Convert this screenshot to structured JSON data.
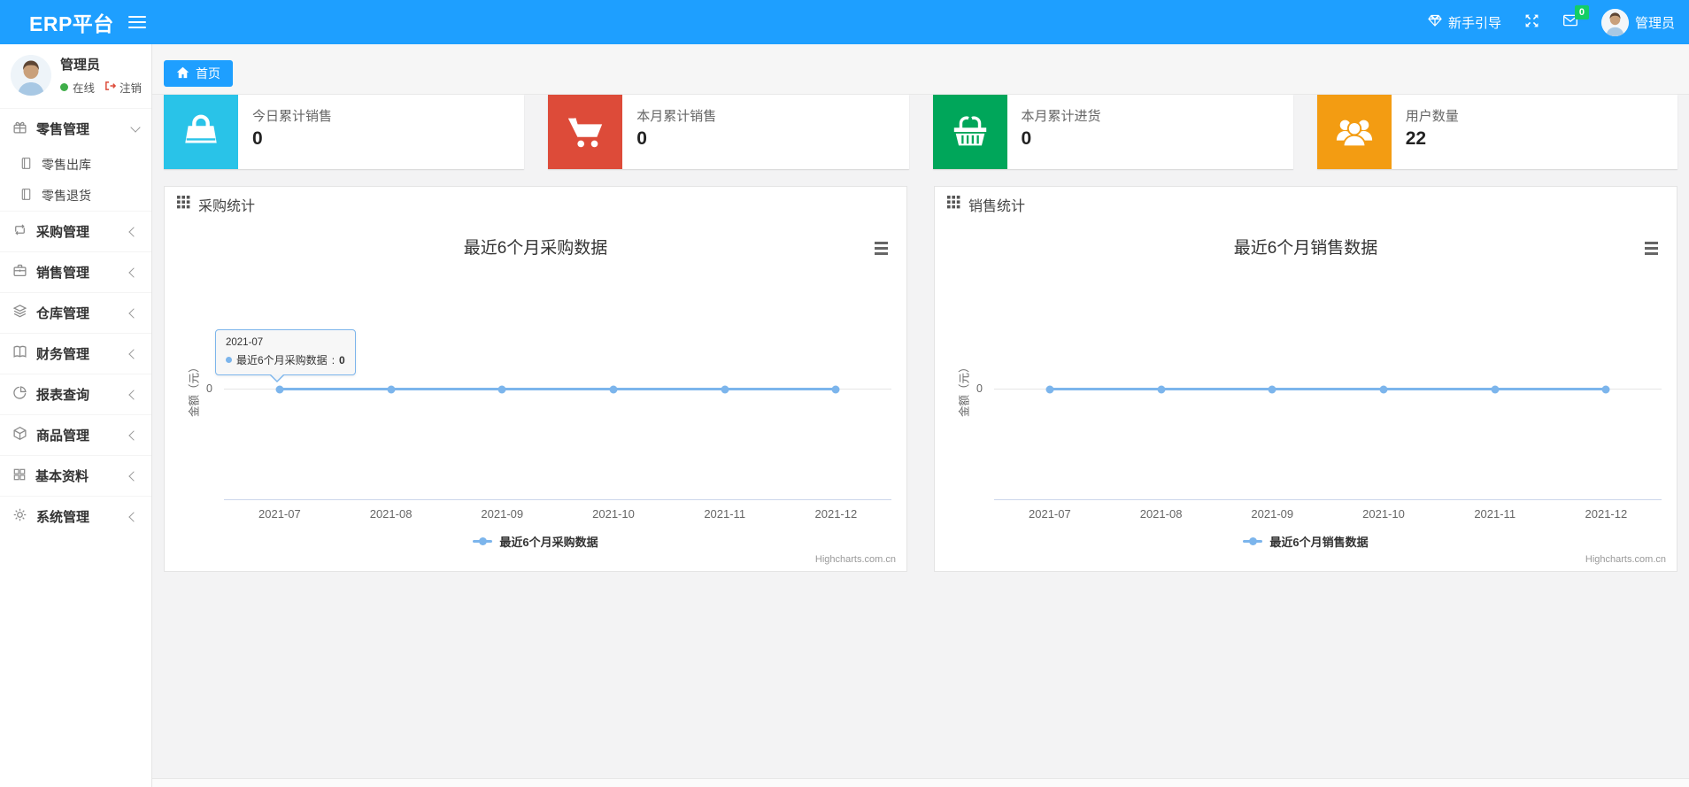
{
  "colors": {
    "accent": "#1e9fff",
    "series": "#7cb5ec",
    "online_green": "#3fae49",
    "badge_green": "#13ce66",
    "logout_red": "#dd4b39"
  },
  "navbar": {
    "brand": "ERP平台",
    "guide_label": "新手引导",
    "message_badge": "0",
    "username": "管理员"
  },
  "tabs": {
    "home_label": "首页"
  },
  "sidebar": {
    "user": {
      "name": "管理员",
      "status": "在线",
      "logout": "注销"
    },
    "menu": [
      {
        "label": "零售管理",
        "icon": "gift-icon",
        "state": "expanded"
      },
      {
        "label": "零售出库",
        "icon": "file-icon"
      },
      {
        "label": "零售退货",
        "icon": "file-icon"
      },
      {
        "label": "采购管理",
        "icon": "retweet-icon"
      },
      {
        "label": "销售管理",
        "icon": "briefcase-icon"
      },
      {
        "label": "仓库管理",
        "icon": "layers-icon"
      },
      {
        "label": "财务管理",
        "icon": "book-icon"
      },
      {
        "label": "报表查询",
        "icon": "pie-chart-icon"
      },
      {
        "label": "商品管理",
        "icon": "box-icon"
      },
      {
        "label": "基本资料",
        "icon": "grid-icon"
      },
      {
        "label": "系统管理",
        "icon": "gear-icon"
      }
    ]
  },
  "stat_cards": [
    {
      "label": "今日累计销售",
      "value": "0",
      "color": "#29c3e8",
      "icon": "shopping-bag-icon"
    },
    {
      "label": "本月累计销售",
      "value": "0",
      "color": "#dd4b39",
      "icon": "shopping-cart-icon"
    },
    {
      "label": "本月累计进货",
      "value": "0",
      "color": "#00a65a",
      "icon": "shopping-basket-icon"
    },
    {
      "label": "用户数量",
      "value": "22",
      "color": "#f39c12",
      "icon": "users-icon"
    }
  ],
  "panels": [
    {
      "header": "采购统计"
    },
    {
      "header": "销售统计"
    }
  ],
  "chart_data": [
    {
      "type": "line",
      "title": "最近6个月采购数据",
      "categories": [
        "2021-07",
        "2021-08",
        "2021-09",
        "2021-10",
        "2021-11",
        "2021-12"
      ],
      "series": [
        {
          "name": "最近6个月采购数据",
          "values": [
            0,
            0,
            0,
            0,
            0,
            0
          ]
        }
      ],
      "ylabel": "金额（元）",
      "yticks": [
        "0"
      ],
      "ylim": [
        0,
        null
      ],
      "grid": true,
      "legend_position": "bottom",
      "color": "#7cb5ec",
      "credits": "Highcharts.com.cn",
      "tooltip": {
        "category": "2021-07",
        "series_name": "最近6个月采购数据",
        "value": "0"
      }
    },
    {
      "type": "line",
      "title": "最近6个月销售数据",
      "categories": [
        "2021-07",
        "2021-08",
        "2021-09",
        "2021-10",
        "2021-11",
        "2021-12"
      ],
      "series": [
        {
          "name": "最近6个月销售数据",
          "values": [
            0,
            0,
            0,
            0,
            0,
            0
          ]
        }
      ],
      "ylabel": "金额（元）",
      "yticks": [
        "0"
      ],
      "ylim": [
        0,
        null
      ],
      "grid": true,
      "legend_position": "bottom",
      "color": "#7cb5ec",
      "credits": "Highcharts.com.cn"
    }
  ]
}
